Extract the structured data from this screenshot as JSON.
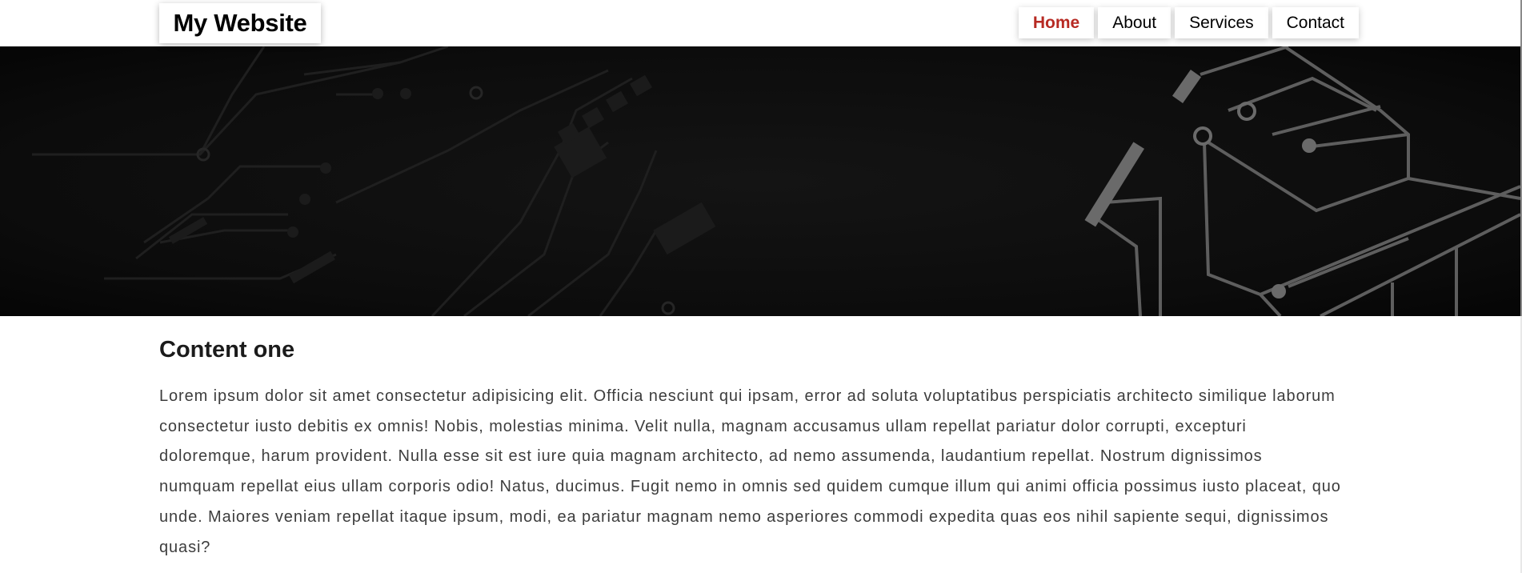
{
  "header": {
    "logo": "My Website",
    "nav": [
      {
        "label": "Home",
        "active": true
      },
      {
        "label": "About",
        "active": false
      },
      {
        "label": "Services",
        "active": false
      },
      {
        "label": "Contact",
        "active": false
      }
    ]
  },
  "hero": {
    "image": "circuit-board-banner"
  },
  "main": {
    "heading": "Content one",
    "paragraph": "Lorem ipsum dolor sit amet consectetur adipisicing elit. Officia nesciunt qui ipsam, error ad soluta voluptatibus perspiciatis architecto similique laborum consectetur iusto debitis ex omnis! Nobis, molestias minima. Velit nulla, magnam accusamus ullam repellat pariatur dolor corrupti, excepturi doloremque, harum provident. Nulla esse sit est iure quia magnam architecto, ad nemo assumenda, laudantium repellat. Nostrum dignissimos numquam repellat eius ullam corporis odio! Natus, ducimus. Fugit nemo in omnis sed quidem cumque illum qui animi officia possimus iusto placeat, quo unde. Maiores veniam repellat itaque ipsum, modi, ea pariatur magnam nemo asperiores commodi expedita quas eos nihil sapiente sequi, dignissimos quasi?"
  },
  "colors": {
    "accent": "#b72a23",
    "hero_bg": "#0c0c0c",
    "text": "#3d3d3d"
  }
}
